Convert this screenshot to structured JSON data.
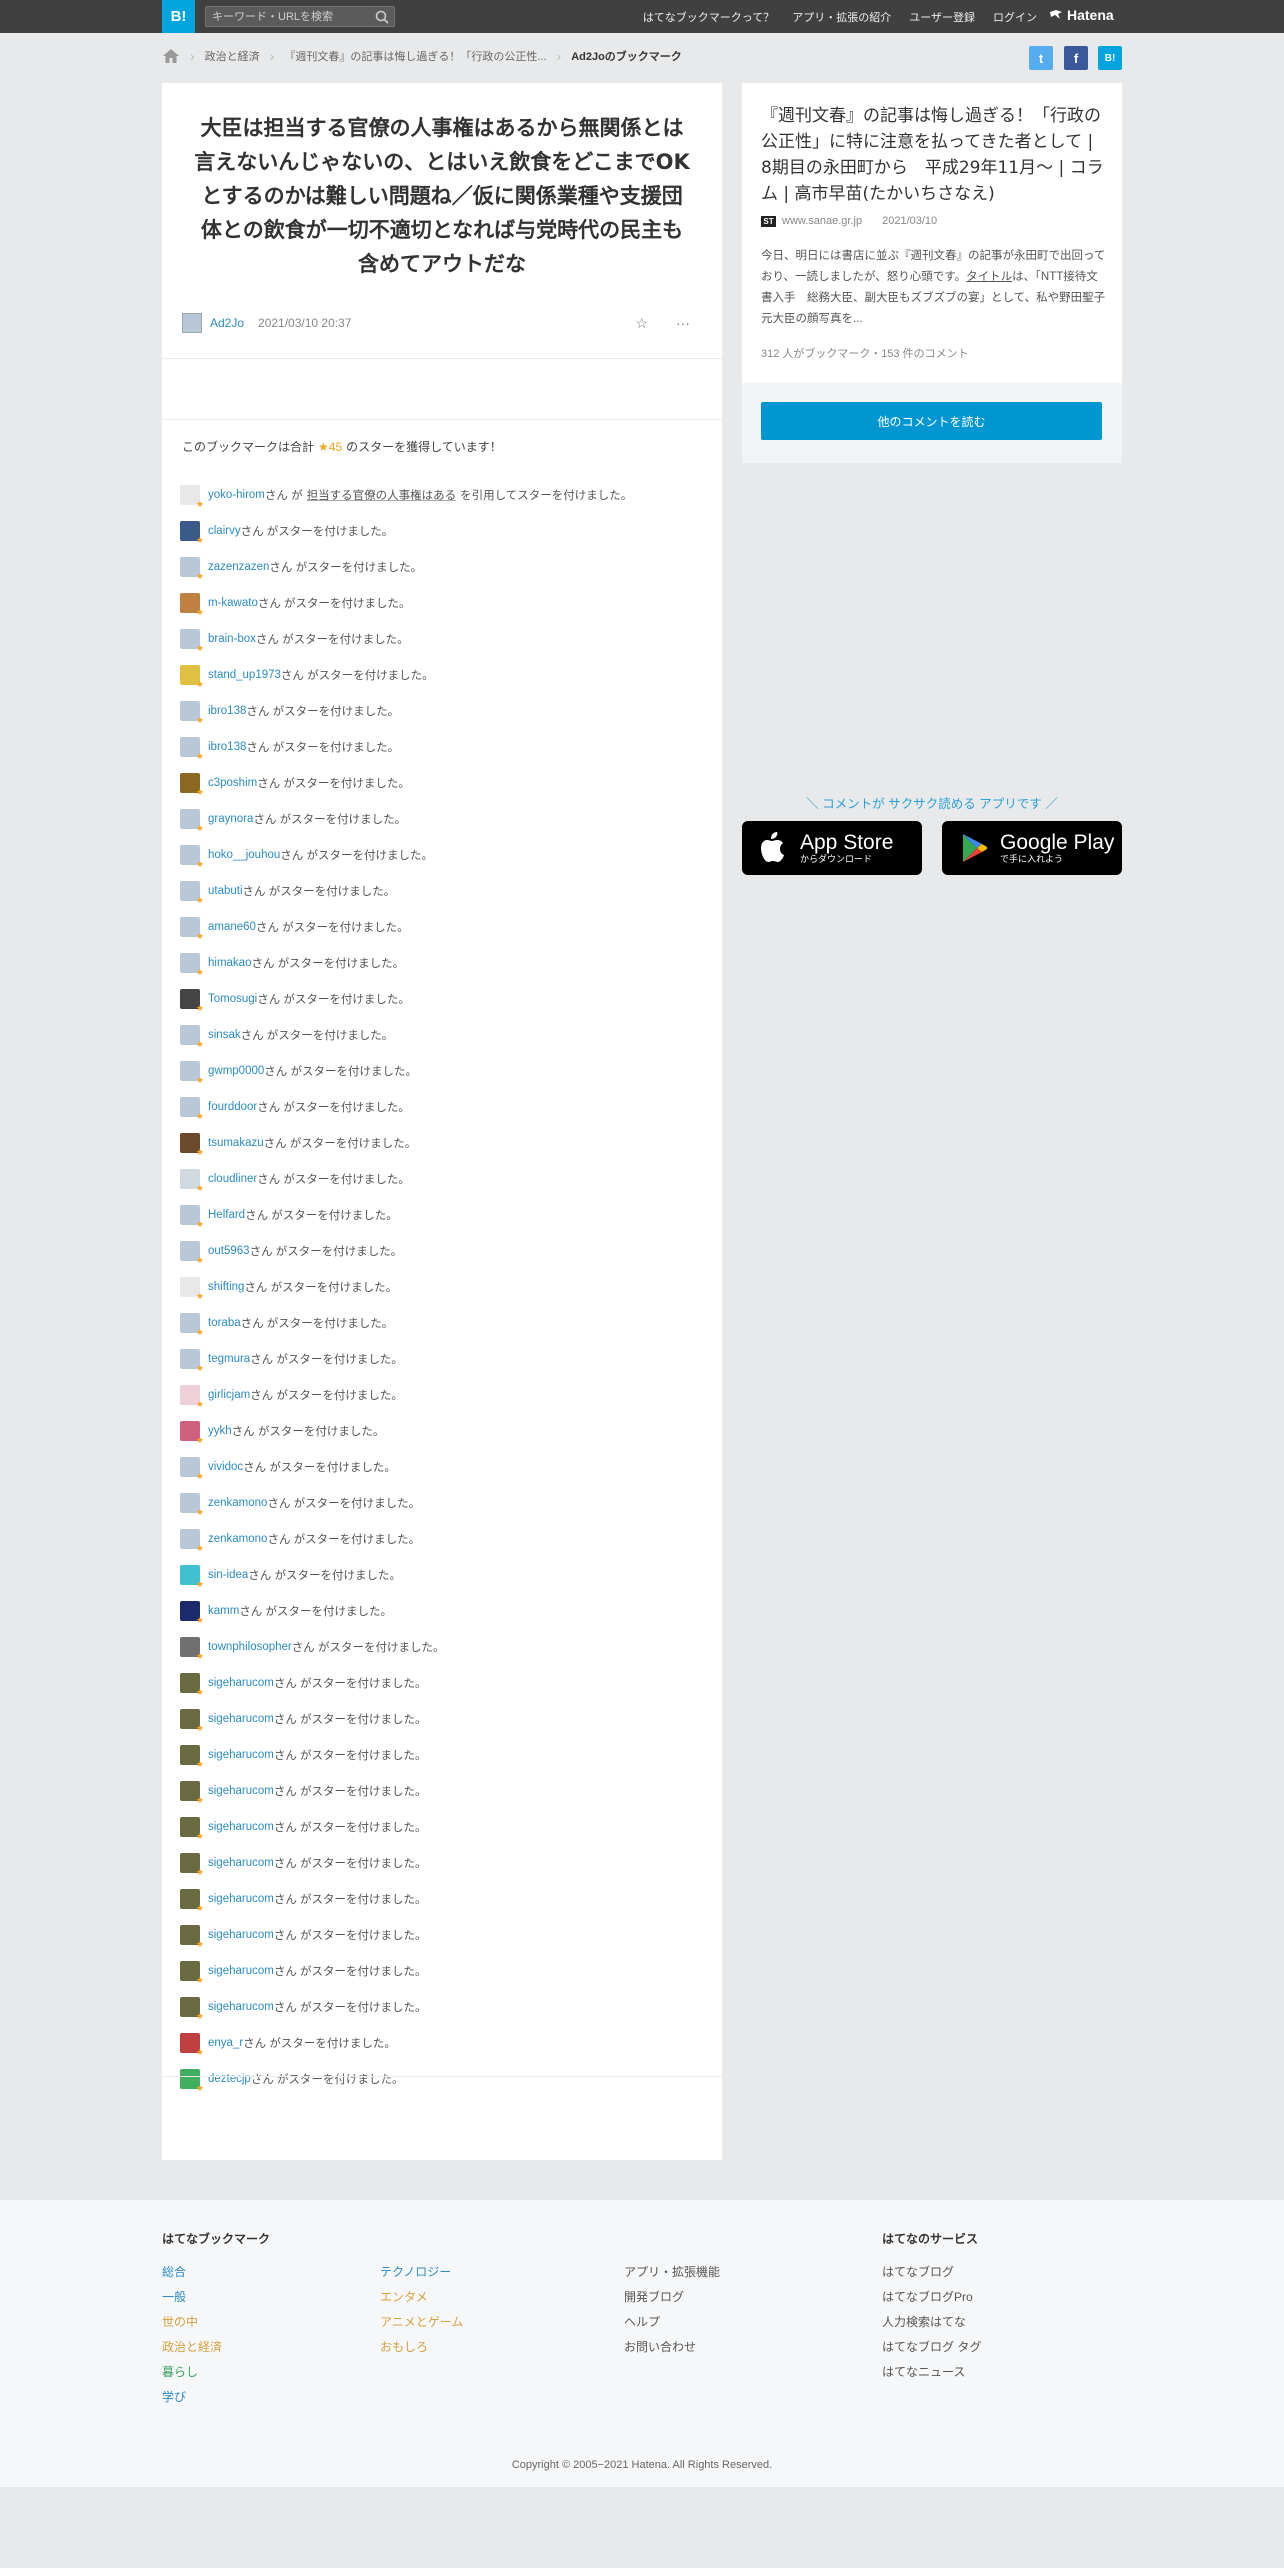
{
  "header": {
    "logo": "B!",
    "search_placeholder": "キーワード・URLを検索",
    "links": [
      "はてなブックマークって？",
      "アプリ・拡張の紹介",
      "ユーザー登録",
      "ログイン"
    ],
    "brand": "Hatena"
  },
  "breadcrumb": {
    "items": [
      "政治と経済",
      "『週刊文春』の記事は悔し過ぎる！「行政の公正性...",
      "Ad2Joのブックマーク"
    ]
  },
  "share": [
    "t",
    "f",
    "B!"
  ],
  "bookmark": {
    "comment": "大臣は担当する官僚の人事権はあるから無関係とは言えないんじゃないの、とはいえ飲食をどこまでOKとするのかは難しい問題ね／仮に関係業種や支援団体との飲食が一切不適切となれば与党時代の民主も含めてアウトだな",
    "user": "Ad2Jo",
    "date": "2021/03/10 20:37",
    "star_icon": "☆",
    "more_icon": "···"
  },
  "stars_summary": {
    "prefix": "このブックマークは合計",
    "count": "★45",
    "suffix": "のスターを獲得しています！"
  },
  "stars": [
    {
      "user": "yoko-hirom",
      "text": "さん が",
      "quote": "担当する官僚の人事権はある",
      "tail": "を引用してスターを付けました。",
      "color": "#e8e8e8"
    },
    {
      "user": "clairvy",
      "text": "さん がスターを付けました。",
      "color": "#3a5a8a"
    },
    {
      "user": "zazenzazen",
      "text": "さん がスターを付けました。",
      "color": "#b8c8d8"
    },
    {
      "user": "m-kawato",
      "text": "さん がスターを付けました。",
      "color": "#c08040"
    },
    {
      "user": "brain-box",
      "text": "さん がスターを付けました。",
      "color": "#b8c8d8"
    },
    {
      "user": "stand_up1973",
      "text": "さん がスターを付けました。",
      "color": "#e0c040"
    },
    {
      "user": "ibro138",
      "text": "さん がスターを付けました。",
      "color": "#b8c8d8"
    },
    {
      "user": "ibro138",
      "text": "さん がスターを付けました。",
      "color": "#b8c8d8"
    },
    {
      "user": "c3poshim",
      "text": "さん がスターを付けました。",
      "color": "#8a6a20"
    },
    {
      "user": "graynora",
      "text": "さん がスターを付けました。",
      "color": "#b8c8d8"
    },
    {
      "user": "hoko__jouhou",
      "text": "さん がスターを付けました。",
      "color": "#b8c8d8"
    },
    {
      "user": "utabuti",
      "text": "さん がスターを付けました。",
      "color": "#b8c8d8"
    },
    {
      "user": "amane60",
      "text": "さん がスターを付けました。",
      "color": "#b8c8d8"
    },
    {
      "user": "himakao",
      "text": "さん がスターを付けました。",
      "color": "#b8c8d8"
    },
    {
      "user": "Tomosugi",
      "text": "さん がスターを付けました。",
      "color": "#444444"
    },
    {
      "user": "sinsak",
      "text": "さん がスターを付けました。",
      "color": "#b8c8d8"
    },
    {
      "user": "gwmp0000",
      "text": "さん がスターを付けました。",
      "color": "#b8c8d8"
    },
    {
      "user": "fourddoor",
      "text": "さん がスターを付けました。",
      "color": "#b8c8d8"
    },
    {
      "user": "tsumakazu",
      "text": "さん がスターを付けました。",
      "color": "#6a4a2a"
    },
    {
      "user": "cloudliner",
      "text": "さん がスターを付けました。",
      "color": "#d0d8e0"
    },
    {
      "user": "Helfard",
      "text": "さん がスターを付けました。",
      "color": "#b8c8d8"
    },
    {
      "user": "out5963",
      "text": "さん がスターを付けました。",
      "color": "#b8c8d8"
    },
    {
      "user": "shifting",
      "text": "さん がスターを付けました。",
      "color": "#e8e8e8"
    },
    {
      "user": "toraba",
      "text": "さん がスターを付けました。",
      "color": "#b8c8d8"
    },
    {
      "user": "tegmura",
      "text": "さん がスターを付けました。",
      "color": "#b8c8d8"
    },
    {
      "user": "girlicjam",
      "text": "さん がスターを付けました。",
      "color": "#f0d0d8"
    },
    {
      "user": "yykh",
      "text": "さん がスターを付けました。",
      "color": "#d06080"
    },
    {
      "user": "vividoc",
      "text": "さん がスターを付けました。",
      "color": "#b8c8d8"
    },
    {
      "user": "zenkamono",
      "text": "さん がスターを付けました。",
      "color": "#b8c8d8"
    },
    {
      "user": "zenkamono",
      "text": "さん がスターを付けました。",
      "color": "#b8c8d8"
    },
    {
      "user": "sin-idea",
      "text": "さん がスターを付けました。",
      "color": "#40c0d0"
    },
    {
      "user": "kamm",
      "text": "さん がスターを付けました。",
      "color": "#1a2a6a"
    },
    {
      "user": "townphilosopher",
      "text": "さん がスターを付けました。",
      "color": "#707070"
    },
    {
      "user": "sigeharucom",
      "text": "さん がスターを付けました。",
      "color": "#6a6a40"
    },
    {
      "user": "sigeharucom",
      "text": "さん がスターを付けました。",
      "color": "#6a6a40"
    },
    {
      "user": "sigeharucom",
      "text": "さん がスターを付けました。",
      "color": "#6a6a40"
    },
    {
      "user": "sigeharucom",
      "text": "さん がスターを付けました。",
      "color": "#6a6a40"
    },
    {
      "user": "sigeharucom",
      "text": "さん がスターを付けました。",
      "color": "#6a6a40"
    },
    {
      "user": "sigeharucom",
      "text": "さん がスターを付けました。",
      "color": "#6a6a40"
    },
    {
      "user": "sigeharucom",
      "text": "さん がスターを付けました。",
      "color": "#6a6a40"
    },
    {
      "user": "sigeharucom",
      "text": "さん がスターを付けました。",
      "color": "#6a6a40"
    },
    {
      "user": "sigeharucom",
      "text": "さん がスターを付けました。",
      "color": "#6a6a40"
    },
    {
      "user": "sigeharucom",
      "text": "さん がスターを付けました。",
      "color": "#6a6a40"
    },
    {
      "user": "enya_r",
      "text": "さん がスターを付けました。",
      "color": "#c04040"
    },
    {
      "user": "deztecjp",
      "text": "さん がスターを付けました。",
      "color": "#40b060"
    }
  ],
  "entry": {
    "title": "『週刊文春』の記事は悔し過ぎる！「行政の公正性」に特に注意を払ってきた者として | 8期目の永田町から　平成29年11月～ | コラム | 高市早苗(たかいちさなえ)",
    "favicon": "ST",
    "domain": "www.sanae.gr.jp",
    "date": "2021/03/10",
    "excerpt_before": "今日、明日には書店に並ぶ『週刊文春』の記事が永田町で出回っており、一読しましたが、怒り心頭です。",
    "excerpt_link": "タイトル",
    "excerpt_after": "は、「NTT接待文書入手　総務大臣、副大臣もズブズブの宴」として、私や野田聖子元大臣の顔写真を...",
    "counts": "312 人がブックマーク・153 件のコメント",
    "more_button": "他のコメントを読む"
  },
  "app_promo": {
    "message": "＼ コメントが サクサク読める アプリです ／",
    "appstore_big": "App Store",
    "appstore_small": "からダウンロード",
    "googleplay_big": "Google Play",
    "googleplay_small": "で手に入れよう"
  },
  "footer": {
    "col1_title": "はてなブックマーク",
    "col1": [
      {
        "label": "総合",
        "color": "#2c8bc3"
      },
      {
        "label": "一般",
        "color": "#2c8bc3"
      },
      {
        "label": "世の中",
        "color": "#d6a040"
      },
      {
        "label": "政治と経済",
        "color": "#d6a040"
      },
      {
        "label": "暮らし",
        "color": "#3aa060"
      },
      {
        "label": "学び",
        "color": "#2c8bc3"
      }
    ],
    "col2": [
      {
        "label": "テクノロジー",
        "color": "#2c8bc3"
      },
      {
        "label": "エンタメ",
        "color": "#d6a040"
      },
      {
        "label": "アニメとゲーム",
        "color": "#d6a040"
      },
      {
        "label": "おもしろ",
        "color": "#d6a040"
      }
    ],
    "col3": [
      "アプリ・拡張機能",
      "開発ブログ",
      "ヘルプ",
      "お問い合わせ"
    ],
    "col4_title": "はてなのサービス",
    "col4": [
      "はてなブログ",
      "はてなブログPro",
      "人力検索はてな",
      "はてなブログ タグ",
      "はてなニュース"
    ],
    "copyright": "Copyright © 2005−2021 Hatena. All Rights Reserved."
  }
}
